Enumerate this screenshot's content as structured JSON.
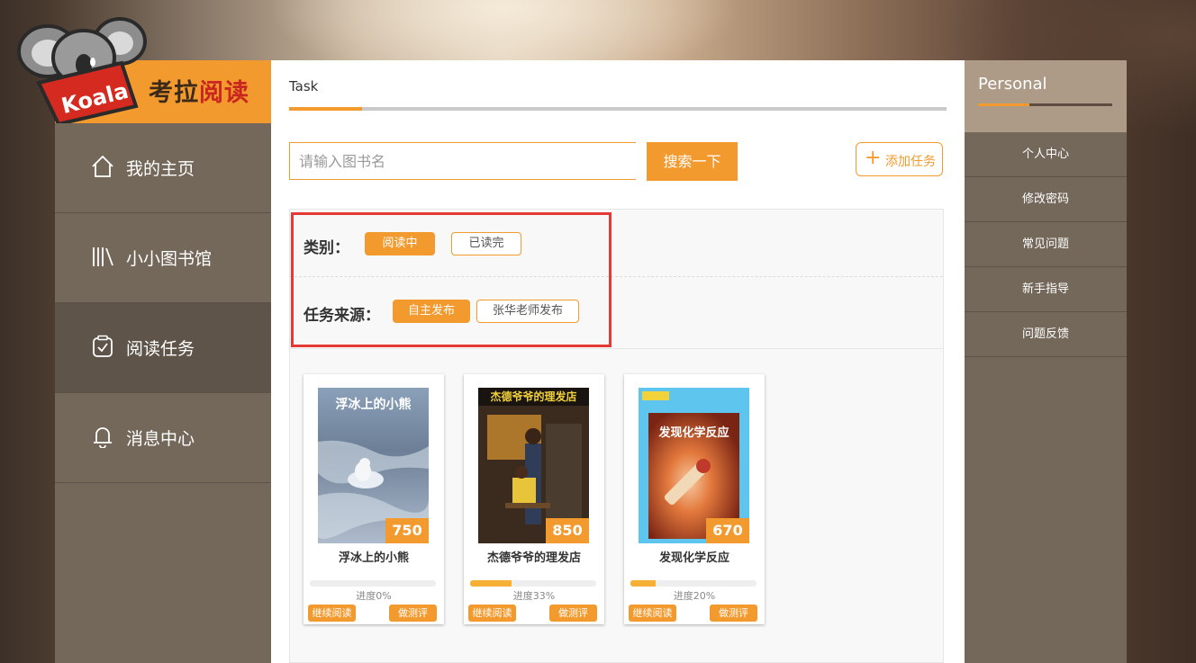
{
  "brand": {
    "logo_text": "Koala",
    "title_prefix": "考拉",
    "title_highlight": "阅读"
  },
  "sidebar": {
    "items": [
      {
        "label": "我的主页",
        "icon": "home-icon",
        "active": false
      },
      {
        "label": "小小图书馆",
        "icon": "library-icon",
        "active": false
      },
      {
        "label": "阅读任务",
        "icon": "clipboard-check-icon",
        "active": true
      },
      {
        "label": "消息中心",
        "icon": "bell-icon",
        "active": false
      }
    ]
  },
  "main": {
    "tab_label": "Task",
    "search": {
      "placeholder": "请输入图书名",
      "button_label": "搜索一下"
    },
    "add_task": {
      "icon": "plus-icon",
      "label": "添加任务"
    },
    "filters": {
      "category": {
        "label": "类别：",
        "options": [
          "阅读中",
          "已读完"
        ],
        "selected": "阅读中"
      },
      "source": {
        "label": "任务来源：",
        "options": [
          "自主发布",
          "张华老师发布"
        ],
        "selected": "自主发布"
      }
    },
    "books": [
      {
        "title": "浮冰上的小熊",
        "cover_title": "浮冰上的小熊",
        "score": "750",
        "progress": 0,
        "progress_text": "进度0%",
        "continue_label": "继续阅读",
        "test_label": "做测评"
      },
      {
        "title": "杰德爷爷的理发店",
        "cover_title": "杰德爷爷的理发店",
        "score": "850",
        "progress": 33,
        "progress_text": "进度33%",
        "continue_label": "继续阅读",
        "test_label": "做测评"
      },
      {
        "title": "发现化学反应",
        "cover_title": "发现化学反应",
        "score": "670",
        "progress": 20,
        "progress_text": "进度20%",
        "continue_label": "继续阅读",
        "test_label": "做测评"
      }
    ]
  },
  "personal": {
    "title": "Personal",
    "items": [
      "个人中心",
      "修改密码",
      "常见问题",
      "新手指导",
      "问题反馈"
    ]
  },
  "colors": {
    "accent": "#f39a2e",
    "sidebar": "#74685b",
    "highlight_box": "#e53935"
  }
}
